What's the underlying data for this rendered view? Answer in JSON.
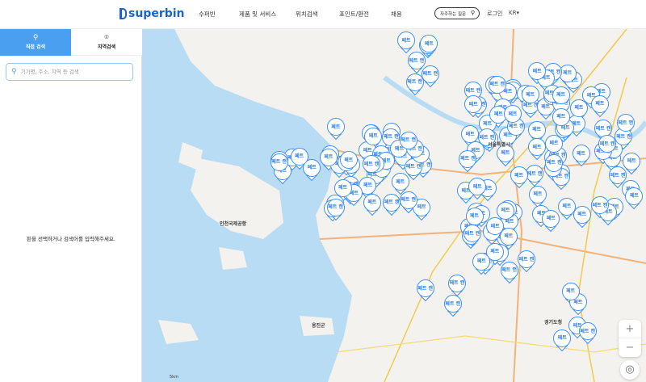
{
  "header": {
    "logo": "superbin",
    "nav": [
      "수퍼빈",
      "제품 및 서비스",
      "위치검색",
      "포인트/환전",
      "채용"
    ],
    "faq": "자주하는 질문",
    "login": "로그인",
    "lang": "KR▾"
  },
  "sidebar": {
    "tabs": [
      {
        "label": "직접 검색",
        "icon": "search-icon",
        "active": true
      },
      {
        "label": "지역검색",
        "icon": "location-pin-icon",
        "active": false
      }
    ],
    "search_placeholder": "기기명, 주소, 지역 등 검색",
    "empty_message": "핀을 선택하거나 검색어를 입력해주세요."
  },
  "map": {
    "pin_labels": [
      "페트",
      "페트 캔"
    ],
    "accent": "#3d8ef0",
    "sea_color": "#b8dcf3",
    "land_color": "#f3f2ee",
    "zoom_in": "+",
    "zoom_out": "−",
    "scale_label": "5km",
    "city_labels": [
      "서울특별시",
      "경기도청",
      "인천국제공항",
      "옹진군"
    ]
  }
}
